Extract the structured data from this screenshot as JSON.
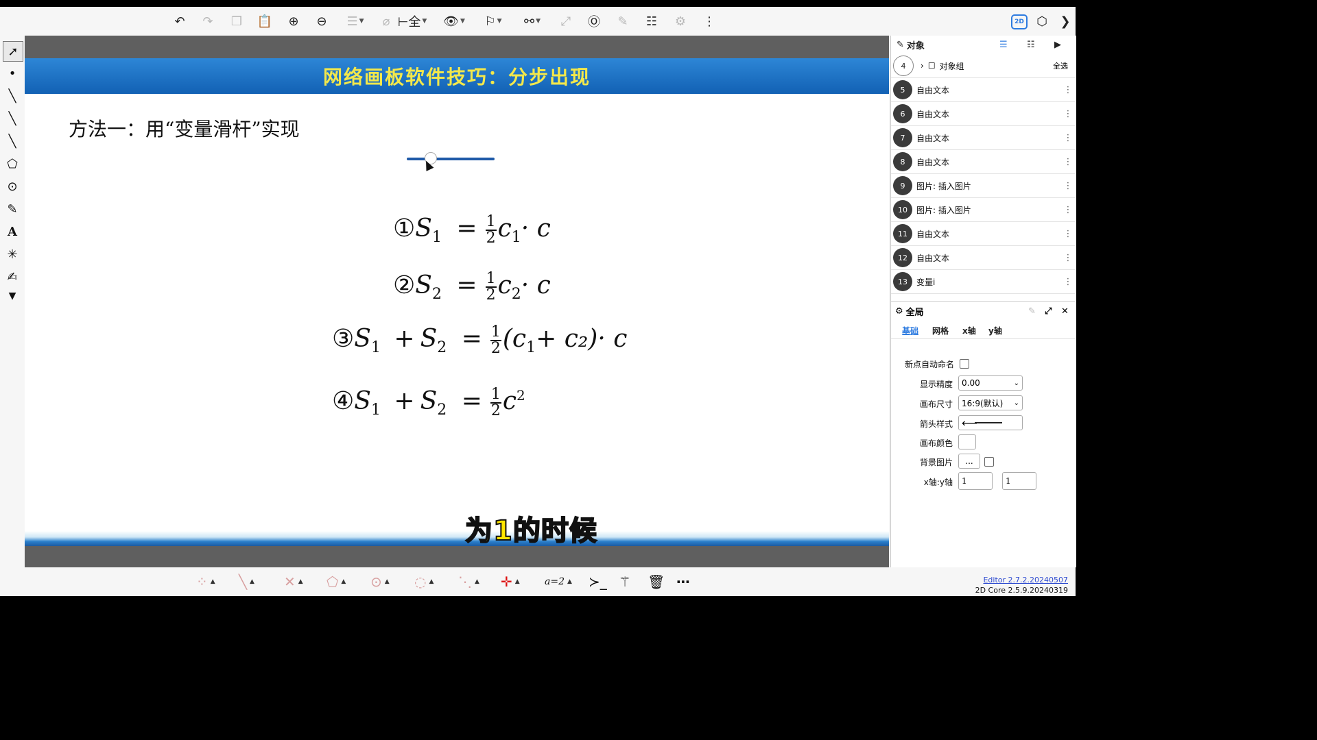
{
  "toolbar": {
    "icons": [
      "undo-icon",
      "redo-icon",
      "copy-icon",
      "paste-icon",
      "zoom-in-icon",
      "zoom-out-icon",
      "align-icon",
      "attach-icon",
      "transform-icon",
      "visibility-icon",
      "flag-icon",
      "connect-icon",
      "resize-icon",
      "reference-icon",
      "edit-icon",
      "settings-list-icon",
      "gear-icon",
      "more-icon"
    ],
    "label_2d": "2D"
  },
  "slide": {
    "banner_title": "网络画板软件技巧：分步出现",
    "method_text": "方法一：用“变量滑杆”实现",
    "subtitle": "为1的时候",
    "formulas": [
      {
        "mark": "①",
        "lhs_a": "S",
        "lhs_a_sub": "1",
        "lhs_op": "",
        "lhs_b": "",
        "lhs_b_sub": "",
        "eq": "=",
        "num": "1",
        "den": "2",
        "rhs": "c",
        "rhs_sub": "1",
        "rhs_tail": "· c"
      },
      {
        "mark": "②",
        "lhs_a": "S",
        "lhs_a_sub": "2",
        "lhs_op": "",
        "lhs_b": "",
        "lhs_b_sub": "",
        "eq": "=",
        "num": "1",
        "den": "2",
        "rhs": "c",
        "rhs_sub": "2",
        "rhs_tail": "· c"
      },
      {
        "mark": "③",
        "lhs_a": "S",
        "lhs_a_sub": "1",
        "lhs_op": "+",
        "lhs_b": "S",
        "lhs_b_sub": "2",
        "eq": "=",
        "num": "1",
        "den": "2",
        "rhs": "(c",
        "rhs_sub": "1",
        "rhs_tail": "+ c₂)· c"
      },
      {
        "mark": "④",
        "lhs_a": "S",
        "lhs_a_sub": "1",
        "lhs_op": "+",
        "lhs_b": "S",
        "lhs_b_sub": "2",
        "eq": "=",
        "num": "1",
        "den": "2",
        "rhs": "c",
        "rhs_sup": "2",
        "rhs_tail": ""
      }
    ]
  },
  "objects_panel": {
    "title": "对象",
    "select_all": "全选",
    "group": {
      "num": "4",
      "label": "对象组"
    },
    "items": [
      {
        "num": "5",
        "label": "自由文本"
      },
      {
        "num": "6",
        "label": "自由文本"
      },
      {
        "num": "7",
        "label": "自由文本"
      },
      {
        "num": "8",
        "label": "自由文本"
      },
      {
        "num": "9",
        "label": "图片: 插入图片"
      },
      {
        "num": "10",
        "label": "图片: 插入图片"
      },
      {
        "num": "11",
        "label": "自由文本"
      },
      {
        "num": "12",
        "label": "自由文本"
      },
      {
        "num": "13",
        "label": "变量i"
      }
    ]
  },
  "global_panel": {
    "title": "全局",
    "tabs": [
      "基础",
      "网格",
      "x轴",
      "y轴"
    ],
    "active_tab": "基础",
    "props": {
      "auto_name_label": "新点自动命名",
      "precision_label": "显示精度",
      "precision_value": "0.00",
      "canvas_size_label": "画布尺寸",
      "canvas_size_value": "16:9(默认)",
      "arrow_style_label": "箭头样式",
      "canvas_color_label": "画布颜色",
      "bg_image_label": "背景图片",
      "bg_image_button": "...",
      "axis_ratio_label": "x轴:y轴",
      "axis_ratio_x": "1",
      "axis_ratio_y": "1"
    }
  },
  "version": {
    "editor": "Editor 2.7.2.20240507",
    "core": "2D Core 2.5.9.20240319"
  },
  "colors": {
    "banner": "#1a6fc4",
    "banner_text": "#f3e84b",
    "accent": "#2d7be0",
    "subtitle": "#ffe600"
  }
}
